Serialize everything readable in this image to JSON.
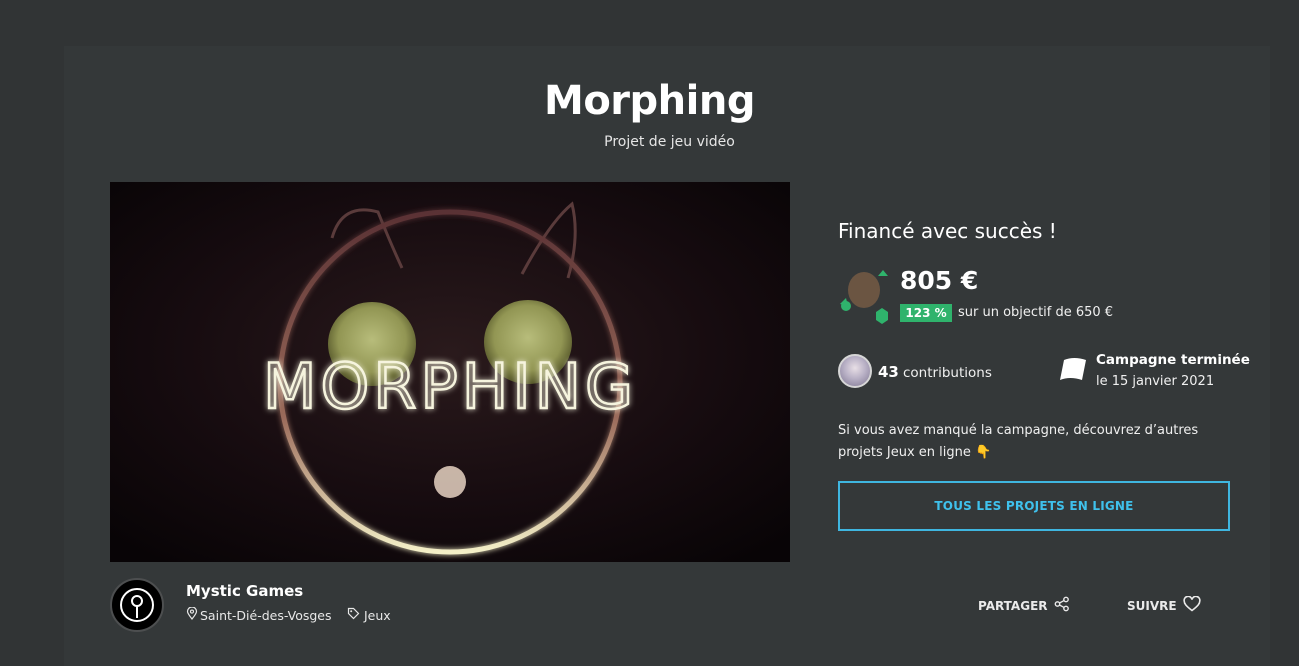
{
  "project": {
    "title": "Morphing",
    "subtitle": "Projet de jeu vidéo",
    "hero_logo_text": "MORPHING"
  },
  "funding": {
    "status_heading": "Financé avec succès !",
    "amount": "805 €",
    "percent": "123 %",
    "goal_text": "sur un objectif de 650 €",
    "percent_value": 123
  },
  "stats": {
    "contributions_count": "43",
    "contributions_label": "contributions",
    "campaign_status": "Campagne terminée",
    "campaign_end_date": "le 15 janvier 2021"
  },
  "missed": {
    "text": "Si vous avez manqué la campagne, découvrez d’autres projets Jeux en ligne 👇"
  },
  "cta": {
    "all_projects_label": "TOUS LES PROJETS EN LIGNE"
  },
  "creator": {
    "name": "Mystic Games",
    "location": "Saint-Dié-des-Vosges",
    "category": "Jeux"
  },
  "actions": {
    "share_label": "PARTAGER",
    "follow_label": "SUIVRE"
  },
  "colors": {
    "background": "#313435",
    "badge_green": "#2fb36c",
    "button_blue": "#3fc1ec"
  },
  "icons": {
    "funding": "funding-mascot-icon",
    "flag": "flag-icon",
    "location": "location-pin-icon",
    "category": "tag-icon",
    "share": "share-icon",
    "follow": "heart-icon"
  }
}
